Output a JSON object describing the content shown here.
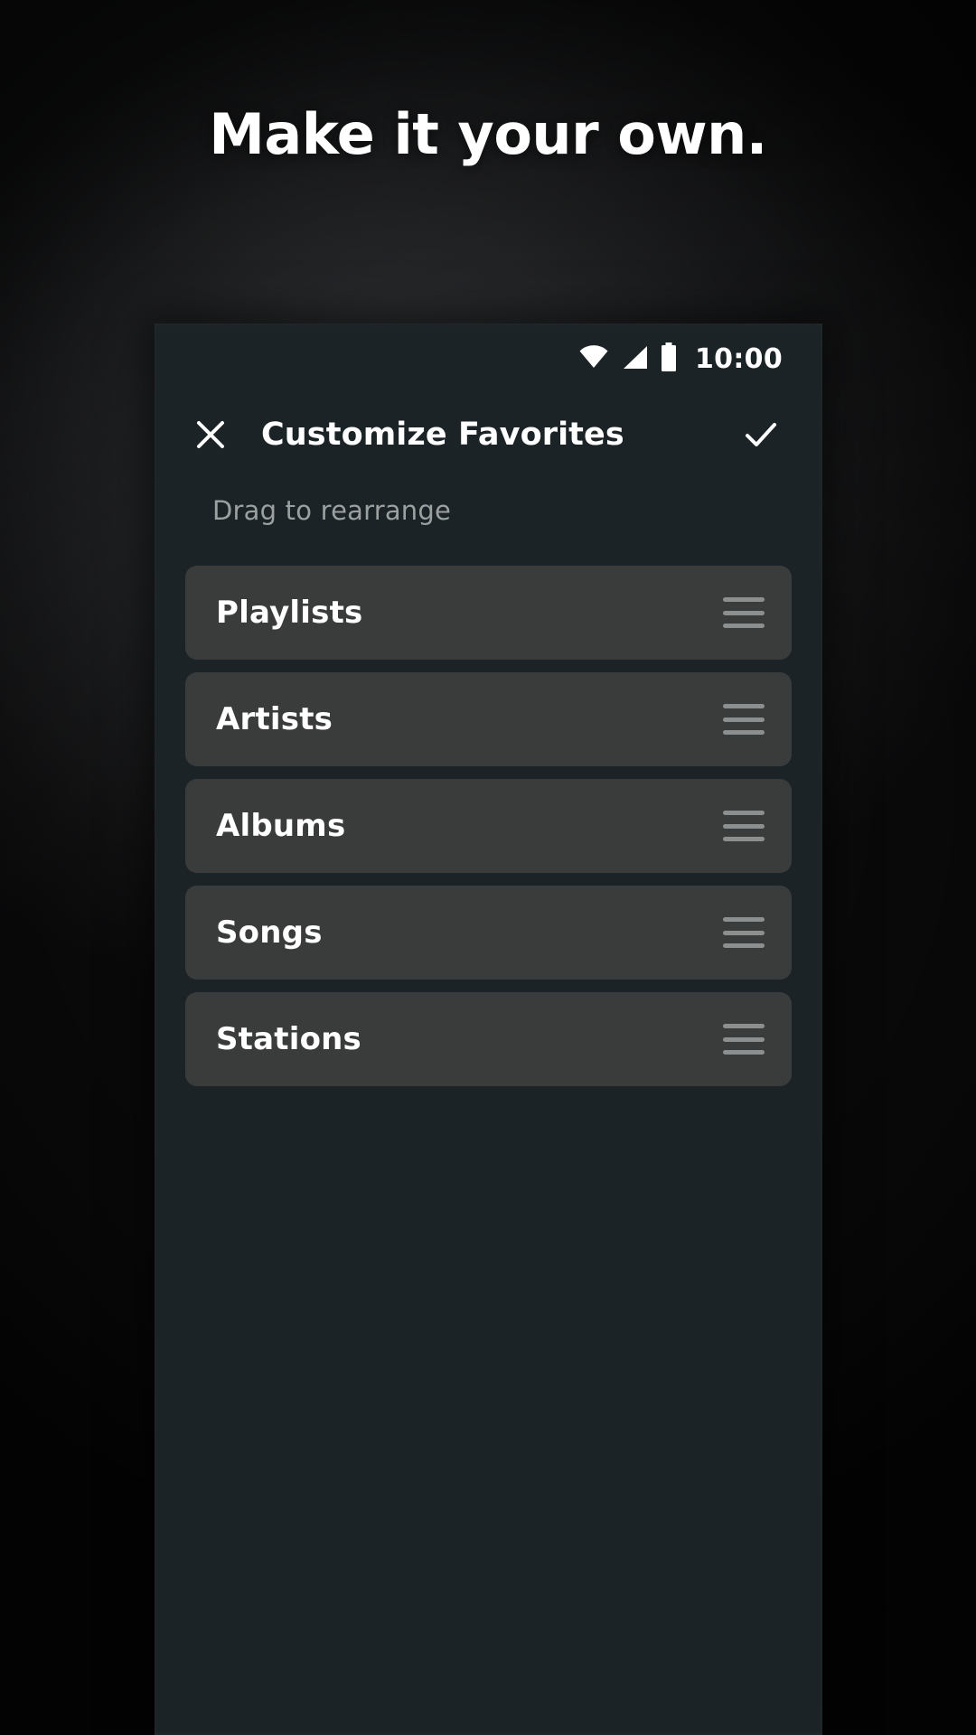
{
  "promo": {
    "headline": "Make it your own."
  },
  "statusbar": {
    "wifi_icon": "wifi-icon",
    "signal_icon": "cellular-signal-icon",
    "battery_icon": "battery-full-icon",
    "clock": "10:00"
  },
  "appbar": {
    "close_icon": "close-icon",
    "title": "Customize Favorites",
    "done_icon": "check-icon"
  },
  "screen": {
    "subtitle": "Drag to rearrange"
  },
  "favorites": {
    "items": [
      {
        "label": "Playlists",
        "handle_icon": "drag-handle-icon"
      },
      {
        "label": "Artists",
        "handle_icon": "drag-handle-icon"
      },
      {
        "label": "Albums",
        "handle_icon": "drag-handle-icon"
      },
      {
        "label": "Songs",
        "handle_icon": "drag-handle-icon"
      },
      {
        "label": "Stations",
        "handle_icon": "drag-handle-icon"
      }
    ]
  },
  "colors": {
    "card_bg": "#3a3c3c",
    "screen_bg": "#1c2326",
    "text_primary": "#ffffff",
    "text_secondary": "#9ba0a1",
    "handle": "#8b8f8f"
  }
}
